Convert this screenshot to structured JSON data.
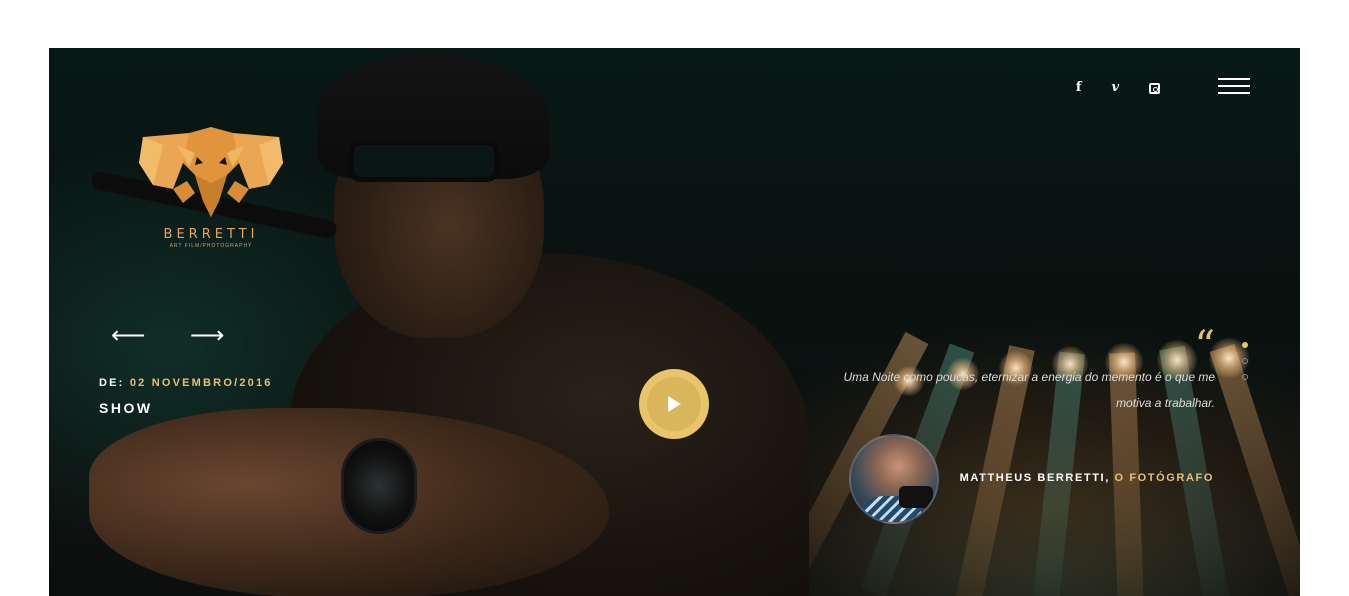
{
  "brand": {
    "name": "BERRETTI",
    "tagline": "ART FILM/PHOTOGRAPHY",
    "logo_icon": "elephant-logo-icon",
    "accent_color": "#e8c56a"
  },
  "social": [
    {
      "name": "facebook",
      "glyph": "f"
    },
    {
      "name": "vimeo",
      "glyph": "v"
    },
    {
      "name": "instagram",
      "glyph": ""
    }
  ],
  "nav": {
    "prev_arrow": "⟵",
    "next_arrow": "⟶",
    "menu_icon": "hamburger-menu-icon"
  },
  "slide": {
    "date_prefix": "DE:",
    "date": "02 NOVEMBRO/2016",
    "title": "SHOW"
  },
  "testimonial": {
    "quote_mark": "“",
    "text": "Uma Noite como poucas, eternizar a energia do memento é o que me motiva a trabalhar.",
    "author": "MATTHEUS BERRETTI,",
    "role": "O FOTÓGRAFO"
  },
  "slider": {
    "total": 3,
    "active_index": 0
  }
}
